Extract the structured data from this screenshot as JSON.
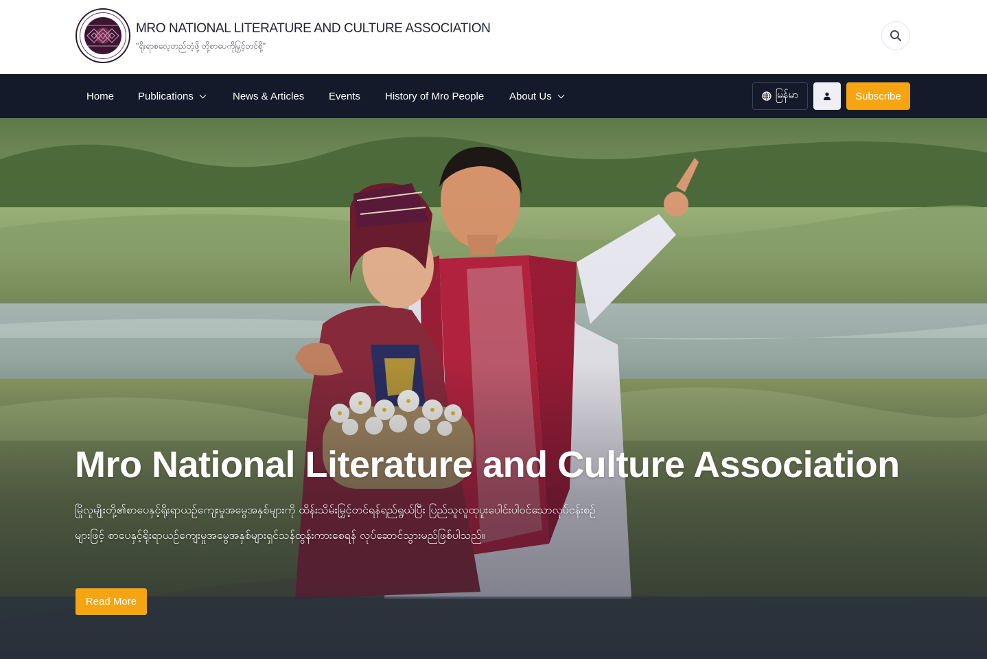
{
  "header": {
    "title": "MRO NATIONAL LITERATURE AND CULTURE ASSOCIATION",
    "tagline": "\"ရိုးရာစလေ့တည်တံ့ဖို့ တို့စာပေကိုမြှင့်တင်စို့\"",
    "logo_icon": "association-seal-logo",
    "search_icon": "search-icon"
  },
  "nav": {
    "items": [
      {
        "label": "Home",
        "has_dropdown": false
      },
      {
        "label": "Publications",
        "has_dropdown": true
      },
      {
        "label": "News & Articles",
        "has_dropdown": false
      },
      {
        "label": "Events",
        "has_dropdown": false
      },
      {
        "label": "History of Mro People",
        "has_dropdown": false
      },
      {
        "label": "About Us",
        "has_dropdown": true
      }
    ],
    "language_label": "မြန်မာ",
    "language_icon": "globe-icon",
    "user_icon": "user-icon",
    "subscribe_label": "Subscribe"
  },
  "hero": {
    "title": "Mro National Literature and Culture Association",
    "description": "မြိုလူမျိုးတို့၏စာပေနှင့်ရိုးရာယဉ်ကျေးမှုအမွေအနှစ်များကို ထိန်းသိမ်းမြှင့်တင်ရန်ရည်ရွယ်ပြီး ပြည်သူလူထုပူးပေါင်းပါဝင်သောလုပ်ငန်းစဉ်များဖြင့် စာပေနှင့်ရိုးရာယဉ်ကျေးမှုအမွေအနှစ်များရှင်သန်ထွန်းကားစေရန် လုပ်ဆောင်သွားမည်ဖြစ်ပါသည်။",
    "read_more_label": "Read More"
  },
  "colors": {
    "nav_background": "#141a2a",
    "accent": "#f5a511",
    "white": "#ffffff"
  }
}
